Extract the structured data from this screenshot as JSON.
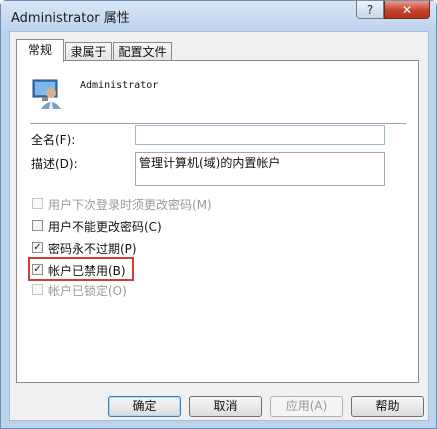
{
  "window": {
    "title": "Administrator 属性",
    "help_label": "?",
    "close_label": "✕"
  },
  "tabs": [
    {
      "label": "常规",
      "active": true
    },
    {
      "label": "隶属于",
      "active": false
    },
    {
      "label": "配置文件",
      "active": false
    }
  ],
  "user": {
    "icon": "user-avatar-icon",
    "name": "Administrator"
  },
  "fields": {
    "fullname": {
      "label": "全名(F):",
      "value": ""
    },
    "description": {
      "label": "描述(D):",
      "value": "管理计算机(域)的内置帐户"
    }
  },
  "checkboxes": [
    {
      "label": "用户下次登录时须更改密码(M)",
      "checked": false,
      "disabled": true
    },
    {
      "label": "用户不能更改密码(C)",
      "checked": false,
      "disabled": false
    },
    {
      "label": "密码永不过期(P)",
      "checked": true,
      "disabled": false
    },
    {
      "label": "帐户已禁用(B)",
      "checked": true,
      "disabled": false
    },
    {
      "label": "帐户已锁定(O)",
      "checked": false,
      "disabled": true
    }
  ],
  "buttons": {
    "ok": "确定",
    "cancel": "取消",
    "apply": "应用(A)",
    "help": "帮助"
  },
  "colors": {
    "highlight": "#d63b38",
    "close_button": "#c4432d"
  }
}
